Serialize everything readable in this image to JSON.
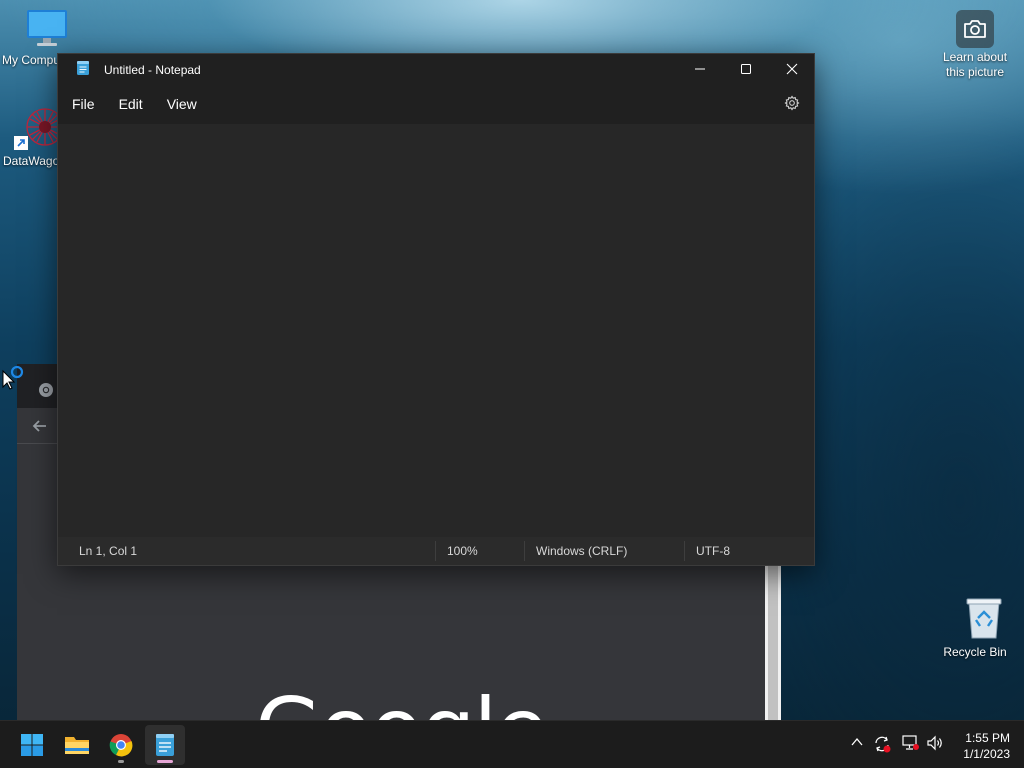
{
  "desktop": {
    "icons": [
      {
        "label": "My Compu",
        "icon": "computer-icon"
      },
      {
        "label": "DataWago",
        "icon": "datawagon-icon"
      },
      {
        "label": "Recycle Bin",
        "icon": "recycle-bin-icon"
      }
    ],
    "spotlight": {
      "label": "Learn about this picture",
      "icon": "camera-icon"
    }
  },
  "chrome": {
    "logo_text": "Google",
    "icons": [
      "chrome-icon",
      "back-arrow-icon"
    ]
  },
  "notepad": {
    "title": "Untitled - Notepad",
    "menu": {
      "file": "File",
      "edit": "Edit",
      "view": "View"
    },
    "content": "",
    "status": {
      "position": "Ln 1, Col 1",
      "zoom": "100%",
      "line_ending": "Windows (CRLF)",
      "encoding": "UTF-8"
    },
    "colors": {
      "background": "#272727",
      "titlebar": "#202020",
      "text": "#ffffff"
    }
  },
  "taskbar": {
    "apps": [
      "start-icon",
      "file-explorer-icon",
      "chrome-icon",
      "notepad-icon"
    ],
    "tray_icons": [
      "chevron-up-icon",
      "sync-error-icon",
      "network-icon",
      "volume-icon"
    ],
    "time": "1:55 PM",
    "date": "1/1/2023"
  }
}
